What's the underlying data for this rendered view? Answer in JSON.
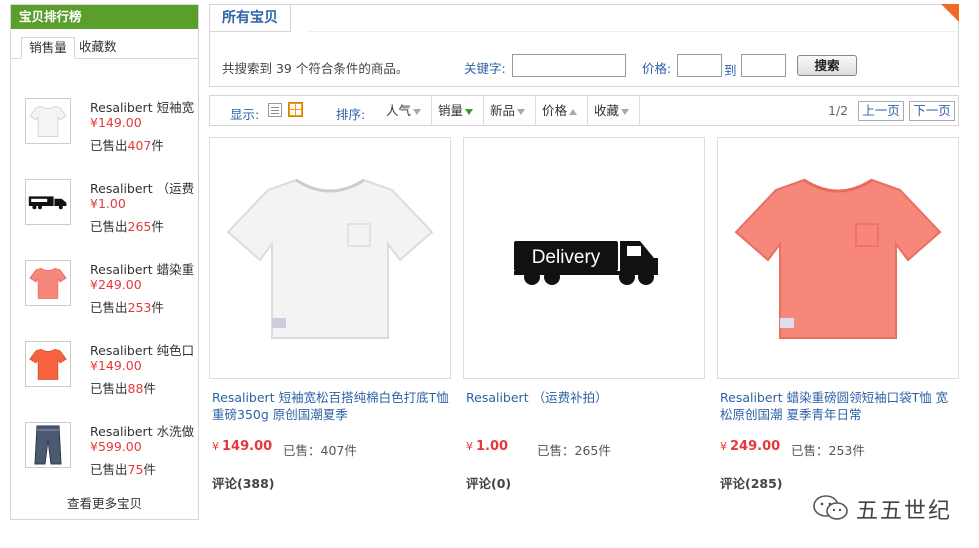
{
  "sidebar": {
    "title": "宝贝排行榜",
    "tabs": [
      "销售量",
      "收藏数"
    ],
    "sold_prefix": "已售出",
    "sold_suffix": "件",
    "items": [
      {
        "name": "Resalibert 短袖宽",
        "price": "¥149.00",
        "sold": "407",
        "thumb": "tshirt-white"
      },
      {
        "name": "Resalibert （运费",
        "price": "¥1.00",
        "sold": "265",
        "thumb": "truck"
      },
      {
        "name": "Resalibert 蜡染重",
        "price": "¥249.00",
        "sold": "253",
        "thumb": "tshirt-pink"
      },
      {
        "name": "Resalibert 纯色口",
        "price": "¥149.00",
        "sold": "88",
        "thumb": "tshirt-orange"
      },
      {
        "name": "Resalibert 水洗做",
        "price": "¥599.00",
        "sold": "75",
        "thumb": "jeans"
      }
    ],
    "more_label": "查看更多宝贝"
  },
  "header": {
    "tab_title": "所有宝贝",
    "found_text": "共搜索到 39 个符合条件的商品。",
    "keyword_label": "关键字:",
    "price_label": "价格:",
    "to_label": "到",
    "search_button": "搜索"
  },
  "sortbar": {
    "display_label": "显示:",
    "sort_label": "排序:",
    "options": [
      "人气",
      "销量",
      "新品",
      "价格",
      "收藏"
    ],
    "page_info": "1/2",
    "prev_label": "上一页",
    "next_label": "下一页"
  },
  "products": [
    {
      "title": "Resalibert 短袖宽松百搭纯棉白色打底T恤重磅350g 原创国潮夏季",
      "currency": "¥",
      "price": "149.00",
      "sold": "已售：407件",
      "comments": "评论(388)",
      "image": "tshirt-white"
    },
    {
      "title": "Resalibert （运费补拍）",
      "currency": "¥",
      "price": "1.00",
      "sold": "已售：265件",
      "comments": "评论(0)",
      "image": "delivery-truck",
      "image_text": "Delivery"
    },
    {
      "title": "Resalibert 蜡染重磅圆领短袖口袋T恤 宽松原创国潮 夏季青年日常",
      "currency": "¥",
      "price": "249.00",
      "sold": "已售：253件",
      "comments": "评论(285)",
      "image": "tshirt-pink"
    }
  ],
  "watermark": {
    "text": "五五世纪",
    "icon": "wechat-icon"
  },
  "colors": {
    "accent_green": "#5a9e2c",
    "link_blue": "#2e63a6",
    "price_red": "#e4393c",
    "corner_orange": "#f26b22",
    "tshirt_pink": "#f7877a",
    "tshirt_orange": "#f5633f"
  }
}
